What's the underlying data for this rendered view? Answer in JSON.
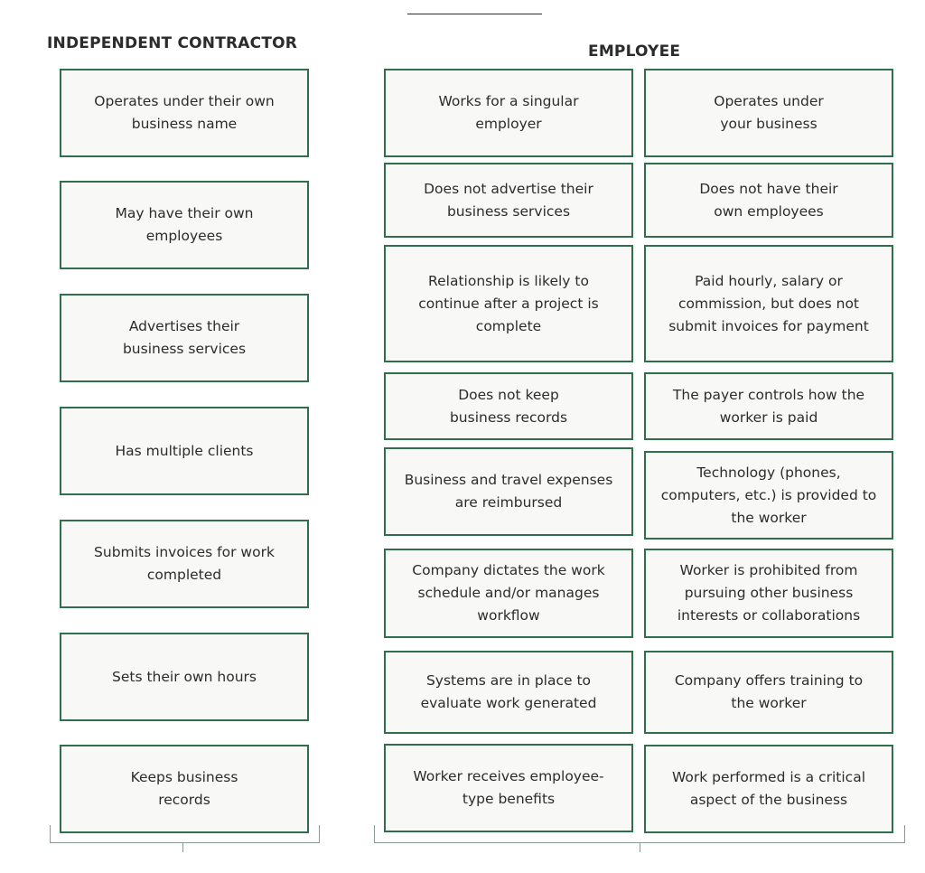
{
  "headings": {
    "independent_contractor": "INDEPENDENT CONTRACTOR",
    "employee": "EMPLOYEE"
  },
  "independent_contractor": [
    "Operates under their own business name",
    "May have their own employees",
    "Advertises their business services",
    "Has multiple clients",
    "Submits invoices for work completed",
    "Sets their own hours",
    "Keeps business records"
  ],
  "employee_left": [
    "Works for a singular employer",
    "Does not advertise their business services",
    "Relationship is likely to continue after a project is complete",
    "Does not keep business records",
    "Business and travel expenses are reimbursed",
    "Company dictates the work schedule and/or manages workflow",
    "Systems are in place to evaluate work generated",
    "Worker receives employee-type benefits"
  ],
  "employee_right": [
    "Operates under your business",
    "Does not have their own employees",
    "Paid hourly, salary or commission, but does not submit invoices for payment",
    "The payer controls how the worker is paid",
    "Technology (phones, computers, etc.) is provided to the worker",
    "Worker is prohibited from pursuing other business interests or collaborations",
    "Company offers training to the worker",
    "Work performed is a critical aspect of the business"
  ],
  "colors": {
    "box_border": "#2f6f4c",
    "box_fill": "#f8f8f7",
    "text": "#2c2c2c"
  }
}
